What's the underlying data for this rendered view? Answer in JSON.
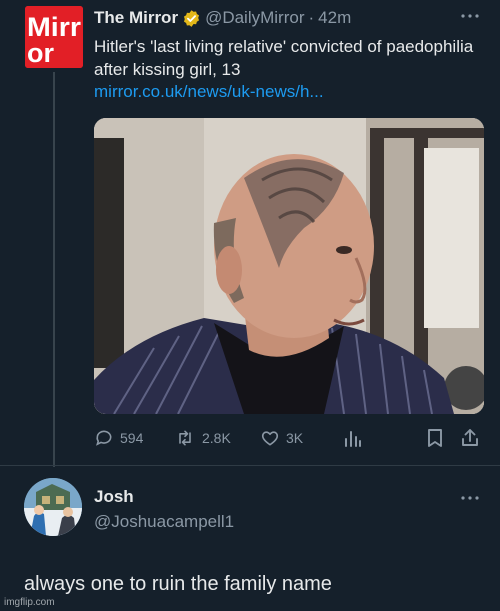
{
  "top_tweet": {
    "logo_text": "Mirror",
    "display_name": "The Mirror",
    "handle": "@DailyMirror",
    "separator": "·",
    "time": "42m",
    "text": "Hitler's 'last living relative' convicted of paedophilia after kissing girl, 13",
    "link": "mirror.co.uk/news/uk-news/h...",
    "actions": {
      "replies": "594",
      "retweets": "2.8K",
      "likes": "3K"
    }
  },
  "reply": {
    "display_name": "Josh",
    "handle": "@Joshuacampell1",
    "text": "always one to ruin the family name"
  },
  "watermark": "imgflip.com",
  "colors": {
    "background": "#15202b",
    "primary_text": "#e7e9ea",
    "secondary_text": "#8b98a5",
    "link": "#1d9bf0",
    "verified_gold": "#e2b719",
    "mirror_red": "#e21f26"
  },
  "icons": [
    "mirror-logo",
    "verified-badge-icon",
    "more-icon",
    "reply-icon",
    "retweet-icon",
    "like-icon",
    "views-icon",
    "bookmark-icon",
    "share-icon"
  ]
}
